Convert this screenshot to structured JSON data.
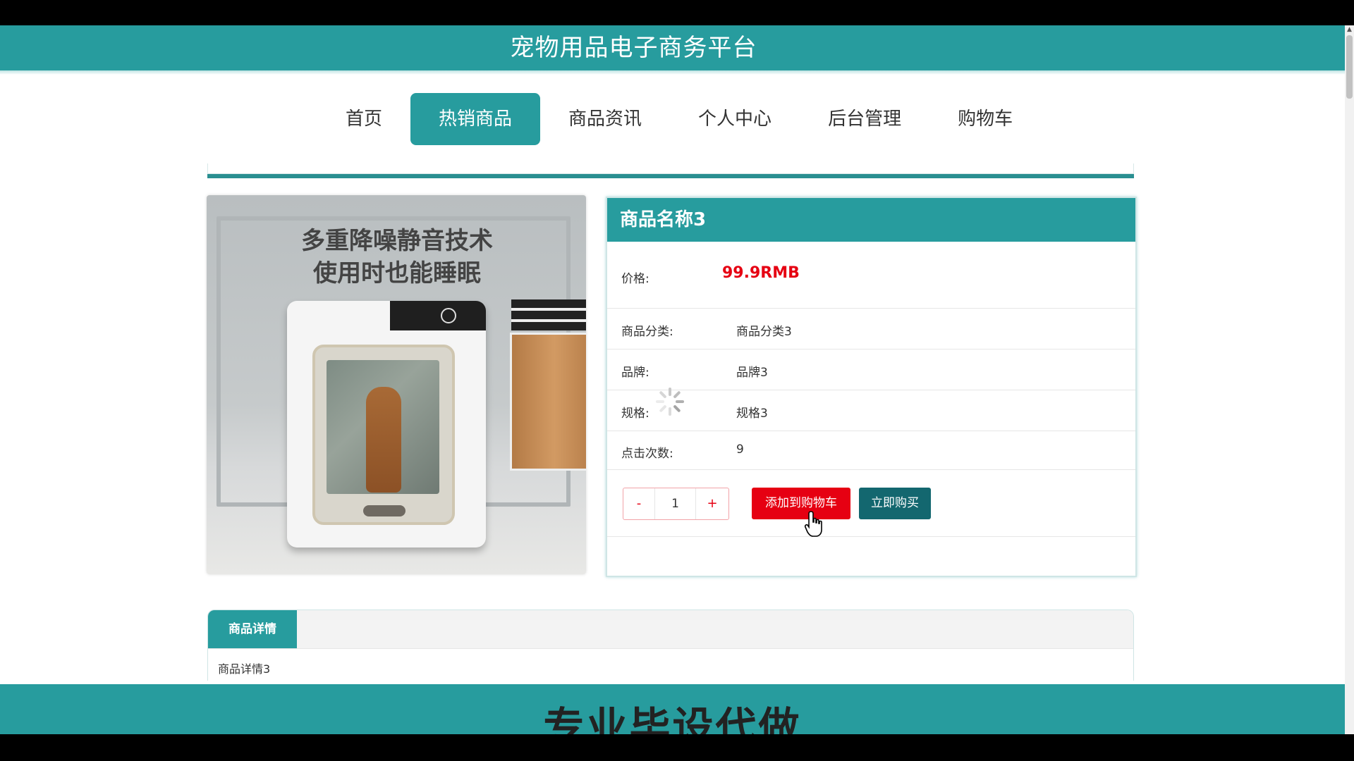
{
  "site": {
    "title": "宠物用品电子商务平台"
  },
  "nav": {
    "items": [
      {
        "label": "首页",
        "active": false
      },
      {
        "label": "热销商品",
        "active": true
      },
      {
        "label": "商品资讯",
        "active": false
      },
      {
        "label": "个人中心",
        "active": false
      },
      {
        "label": "后台管理",
        "active": false
      },
      {
        "label": "购物车",
        "active": false
      }
    ]
  },
  "product": {
    "image_caption_line1": "多重降噪静音技术",
    "image_caption_line2": "使用时也能睡眠",
    "name": "商品名称3",
    "price_label": "价格:",
    "price": "99.9RMB",
    "category_label": "商品分类:",
    "category": "商品分类3",
    "brand_label": "品牌:",
    "brand": "品牌3",
    "spec_label": "规格:",
    "spec": "规格3",
    "clicks_label": "点击次数:",
    "clicks": "9"
  },
  "quantity": {
    "minus": "-",
    "value": "1",
    "plus": "+"
  },
  "actions": {
    "add_to_cart": "添加到购物车",
    "buy_now": "立即购买"
  },
  "details": {
    "tab_label": "商品详情",
    "content": "商品详情3"
  },
  "footer": {
    "banner_text": "专业毕设代做"
  },
  "colors": {
    "primary": "#279c9e",
    "price": "#e60012",
    "cart_button": "#e60012",
    "buy_button": "#13676f"
  }
}
